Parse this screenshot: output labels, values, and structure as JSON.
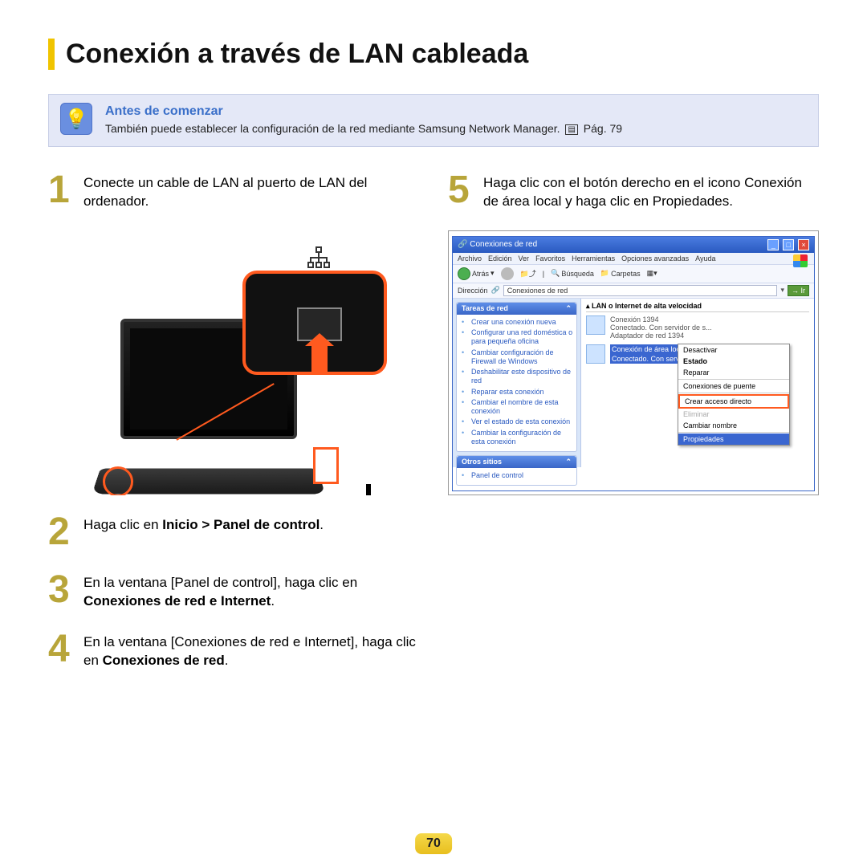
{
  "title": "Conexión a través de LAN cableada",
  "info": {
    "heading": "Antes de comenzar",
    "text_a": "También puede establecer la configuración de la red mediante Samsung Network Manager. ",
    "page_ref": "Pág. 79"
  },
  "steps": {
    "s1": {
      "num": "1",
      "text": "Conecte un cable de LAN al puerto de LAN del ordenador."
    },
    "s2": {
      "num": "2",
      "pre": "Haga clic en ",
      "bold": "Inicio > Panel de control",
      "post": "."
    },
    "s3": {
      "num": "3",
      "pre": "En la ventana [Panel de control], haga clic en ",
      "bold": "Conexiones de red e Internet",
      "post": "."
    },
    "s4": {
      "num": "4",
      "pre": "En la ventana [Conexiones de red e Internet], haga clic en ",
      "bold": "Conexiones de red",
      "post": "."
    },
    "s5": {
      "num": "5",
      "text": "Haga clic con el botón derecho en el icono Conexión de área local y haga clic en Propiedades."
    }
  },
  "window": {
    "title": "Conexiones de red",
    "menu": [
      "Archivo",
      "Edición",
      "Ver",
      "Favoritos",
      "Herramientas",
      "Opciones avanzadas",
      "Ayuda"
    ],
    "toolbar": {
      "back": "Atrás",
      "search": "Búsqueda",
      "folders": "Carpetas"
    },
    "address_label": "Dirección",
    "address_value": "Conexiones de red",
    "go": "Ir",
    "side1_title": "Tareas de red",
    "side1_items": [
      "Crear una conexión nueva",
      "Configurar una red doméstica o para pequeña oficina",
      "Cambiar configuración de Firewall de Windows",
      "Deshabilitar este dispositivo de red",
      "Reparar esta conexión",
      "Cambiar el nombre de esta conexión",
      "Ver el estado de esta conexión",
      "Cambiar la configuración de esta conexión"
    ],
    "side2_title": "Otros sitios",
    "side2_items": [
      "Panel de control"
    ],
    "section": "LAN o Internet de alta velocidad",
    "conn1": {
      "name": "Conexión 1394",
      "sub1": "Conectado. Con servidor de s...",
      "sub2": "Adaptador de red 1394"
    },
    "conn2": {
      "name": "Conexión de área local",
      "sub": "Conectado. Con servidor de s..."
    },
    "ctx": {
      "disable": "Desactivar",
      "status": "Estado",
      "repair": "Reparar",
      "bridge": "Conexiones de puente",
      "shortcut": "Crear acceso directo",
      "delete": "Eliminar",
      "rename": "Cambiar nombre",
      "props": "Propiedades"
    }
  },
  "page_number": "70"
}
